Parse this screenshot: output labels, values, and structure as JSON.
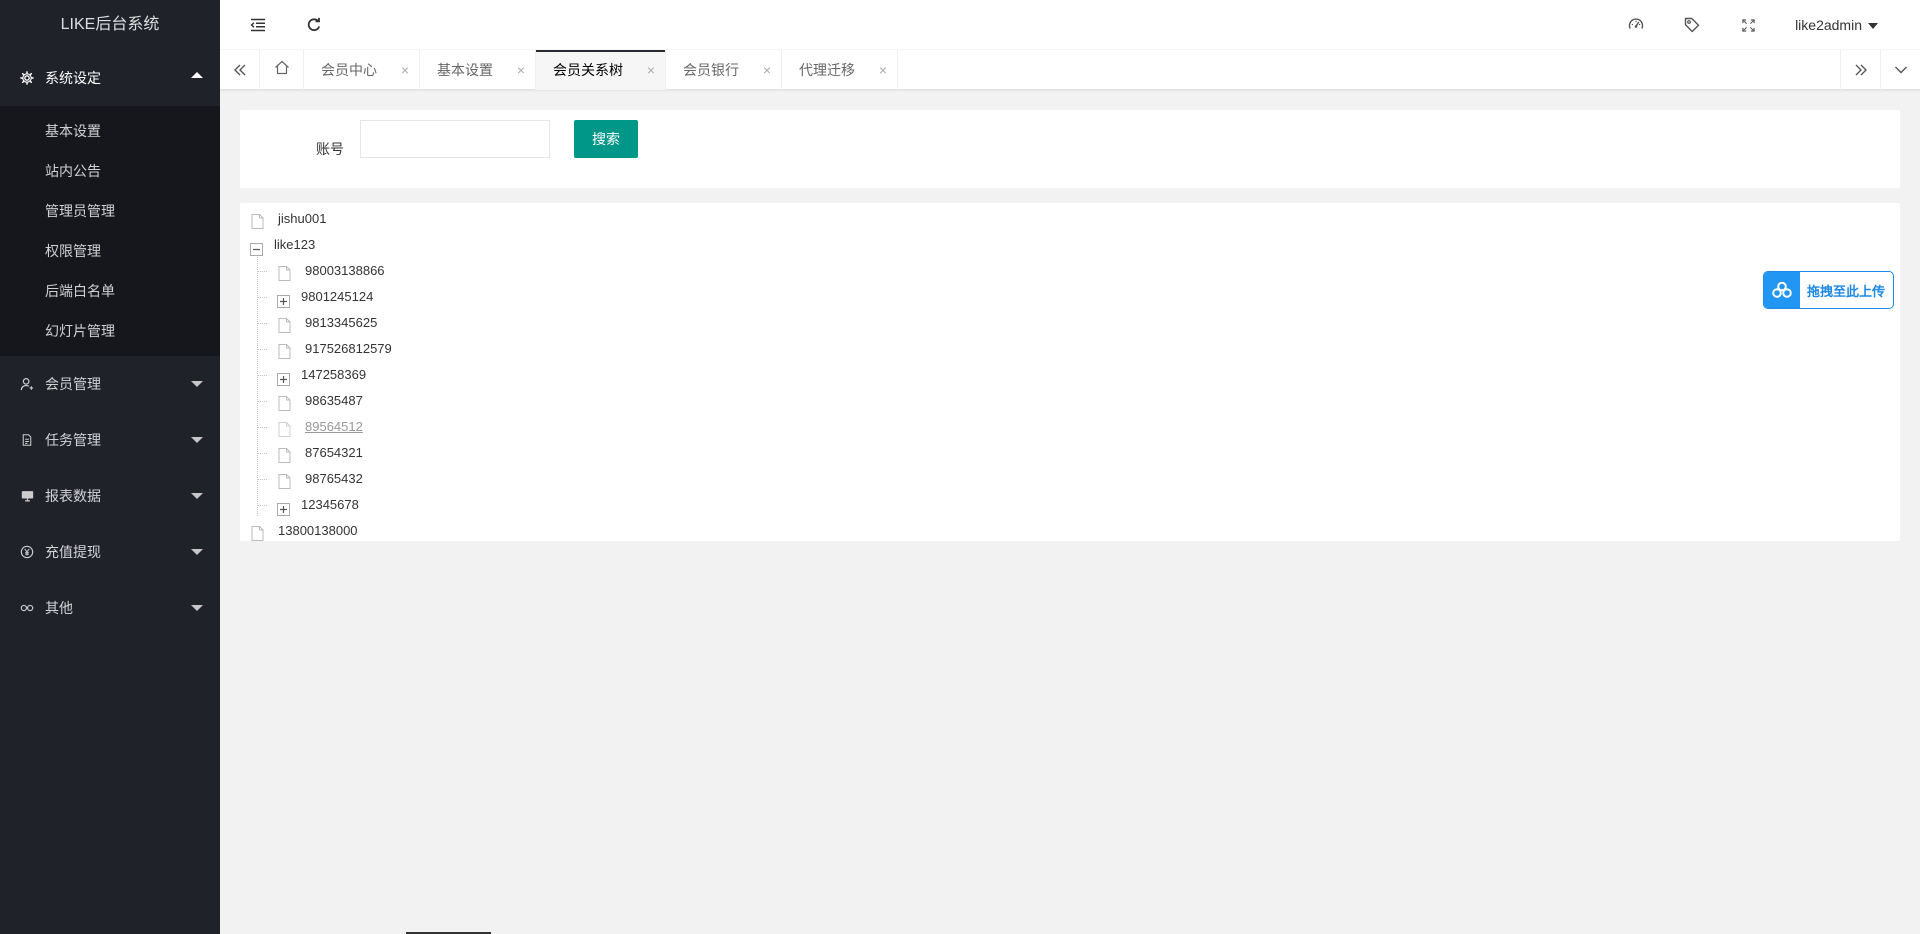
{
  "app": {
    "title": "LIKE后台系统"
  },
  "sidebar": {
    "groups": [
      {
        "label": "系统设定",
        "icon": "gear-icon",
        "open": true,
        "items": [
          {
            "label": "基本设置"
          },
          {
            "label": "站内公告"
          },
          {
            "label": "管理员管理"
          },
          {
            "label": "权限管理"
          },
          {
            "label": "后端白名单"
          },
          {
            "label": "幻灯片管理"
          }
        ]
      },
      {
        "label": "会员管理",
        "icon": "user-icon",
        "open": false
      },
      {
        "label": "任务管理",
        "icon": "document-icon",
        "open": false
      },
      {
        "label": "报表数据",
        "icon": "chart-icon",
        "open": false
      },
      {
        "label": "充值提现",
        "icon": "yen-icon",
        "open": false
      },
      {
        "label": "其他",
        "icon": "link-icon",
        "open": false
      }
    ]
  },
  "header": {
    "icons": [
      "shrink-menu-icon",
      "refresh-icon",
      "theme-icon",
      "tag-icon",
      "fullscreen-icon"
    ],
    "user": "like2admin"
  },
  "tabs": {
    "items": [
      {
        "label": "会员中心",
        "active": false
      },
      {
        "label": "基本设置",
        "active": false
      },
      {
        "label": "会员关系树",
        "active": true
      },
      {
        "label": "会员银行",
        "active": false
      },
      {
        "label": "代理迁移",
        "active": false
      }
    ],
    "close_glyph": "×"
  },
  "search": {
    "label": "账号",
    "value": "",
    "placeholder": "",
    "button": "搜索"
  },
  "tree": {
    "nodes": [
      {
        "label": "jishu001",
        "type": "leaf",
        "level": 0
      },
      {
        "label": "like123",
        "type": "expanded",
        "level": 0,
        "children": [
          {
            "label": "98003138866",
            "type": "leaf"
          },
          {
            "label": "9801245124",
            "type": "collapsed"
          },
          {
            "label": "9813345625",
            "type": "leaf"
          },
          {
            "label": "917526812579",
            "type": "leaf"
          },
          {
            "label": "147258369",
            "type": "collapsed"
          },
          {
            "label": "98635487",
            "type": "leaf"
          },
          {
            "label": "89564512",
            "type": "leaf",
            "hovered": true
          },
          {
            "label": "87654321",
            "type": "leaf"
          },
          {
            "label": "98765432",
            "type": "leaf"
          },
          {
            "label": "12345678",
            "type": "collapsed"
          }
        ]
      },
      {
        "label": "13800138000",
        "type": "leaf",
        "level": 0
      }
    ]
  },
  "upload_widget": {
    "label": "拖拽至此上传",
    "icon": "cloud-icon",
    "color": "#2196f3"
  },
  "colors": {
    "sidebar_bg": "#20222a",
    "primary_button": "#009688",
    "page_bg": "#f2f2f2"
  }
}
